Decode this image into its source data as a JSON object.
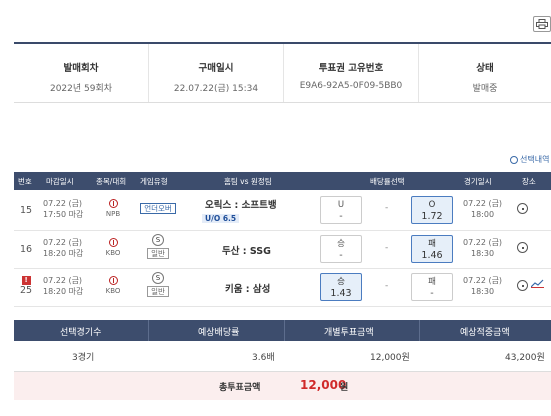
{
  "info": {
    "columns": [
      {
        "header": "발매회차",
        "value": "2022년 59회차"
      },
      {
        "header": "구매일시",
        "value": "22.07.22(금) 15:34"
      },
      {
        "header": "투표권 고유번호",
        "value": "E9A6-92A5-0F09-5BB0"
      },
      {
        "header": "상태",
        "value": "발매중"
      }
    ]
  },
  "select_check_label": "선택내역",
  "table": {
    "headers": [
      "번호",
      "마감일시",
      "종목/대회",
      "게임유형",
      "홈팀 vs 원정팀",
      "배당률선택",
      "경기일시",
      "장소"
    ],
    "rows": [
      {
        "no": "15",
        "close_date": "07.22 (금)",
        "close_time": "17:50 마감",
        "league": "NPB",
        "game_type": "언더오버",
        "match": "오릭스 : 소프트뱅",
        "uo": "U/O 6.5",
        "odds_left": {
          "label": "U",
          "value": "-"
        },
        "odds_mid": "-",
        "odds_right": {
          "label": "O",
          "value": "1.72"
        },
        "selected": "right",
        "game_date": "07.22 (금)",
        "game_time": "18:00"
      },
      {
        "no": "16",
        "close_date": "07.22 (금)",
        "close_time": "18:20 마감",
        "league": "KBO",
        "game_type": "일반",
        "type_icon": "S",
        "match": "두산 : SSG",
        "uo": "",
        "odds_left": {
          "label": "승",
          "value": "-"
        },
        "odds_mid": "-",
        "odds_right": {
          "label": "패",
          "value": "1.46"
        },
        "selected": "right",
        "game_date": "07.22 (금)",
        "game_time": "18:30"
      },
      {
        "no": "25",
        "close_date": "07.22 (금)",
        "close_time": "18:20 마감",
        "league": "KBO",
        "game_type": "일반",
        "type_icon": "S",
        "match": "키움 : 삼성",
        "uo": "",
        "warn": "!",
        "odds_left": {
          "label": "승",
          "value": "1.43"
        },
        "odds_mid": "-",
        "odds_right": {
          "label": "패",
          "value": "-"
        },
        "selected": "left",
        "game_date": "07.22 (금)",
        "game_time": "18:30"
      }
    ]
  },
  "summary": {
    "headers": [
      "선택경기수",
      "예상배당률",
      "개별투표금액",
      "예상적중금액"
    ],
    "values": [
      "3경기",
      "3.6배",
      "12,000원",
      "43,200원"
    ]
  },
  "total": {
    "label": "총투표금액",
    "amount": "12,000",
    "unit": "원"
  }
}
